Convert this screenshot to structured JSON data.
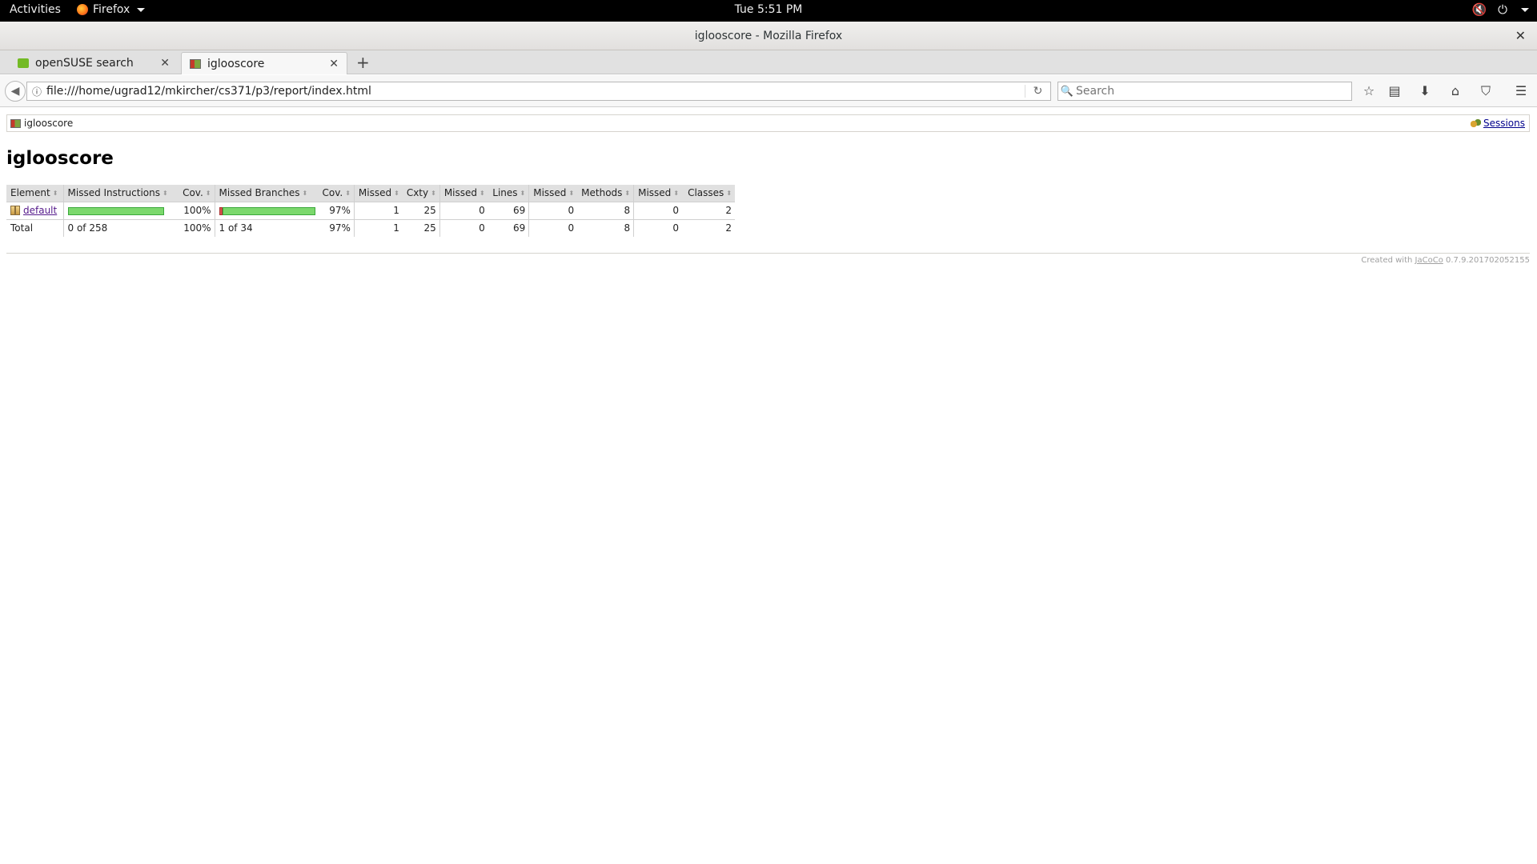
{
  "topbar": {
    "activities": "Activities",
    "app_name": "Firefox",
    "clock": "Tue  5:51 PM"
  },
  "window": {
    "title": "iglooscore - Mozilla Firefox"
  },
  "tabs": [
    {
      "label": "openSUSE search",
      "active": false
    },
    {
      "label": "iglooscore",
      "active": true
    }
  ],
  "navbar": {
    "url": "file:///home/ugrad12/mkircher/cs371/p3/report/index.html",
    "search_placeholder": "Search"
  },
  "report": {
    "breadcrumb": "iglooscore",
    "sessions_label": "Sessions",
    "title": "iglooscore",
    "headers": {
      "element": "Element",
      "missed_instructions": "Missed Instructions",
      "cov1": "Cov.",
      "missed_branches": "Missed Branches",
      "cov2": "Cov.",
      "missed_cxty": "Missed",
      "cxty": "Cxty",
      "missed_lines": "Missed",
      "lines": "Lines",
      "missed_methods": "Missed",
      "methods": "Methods",
      "missed_classes": "Missed",
      "classes": "Classes"
    },
    "rows": [
      {
        "element": "default",
        "instr_cov_pct": "100%",
        "instr_coverage_fraction": 1.0,
        "branch_cov_pct": "97%",
        "branch_coverage_fraction": 0.97,
        "missed_cxty": "1",
        "cxty": "25",
        "missed_lines": "0",
        "lines": "69",
        "missed_methods": "0",
        "methods": "8",
        "missed_classes": "0",
        "classes": "2"
      }
    ],
    "total": {
      "label": "Total",
      "missed_instructions": "0 of 258",
      "cov1": "100%",
      "missed_branches": "1 of 34",
      "cov2": "97%",
      "missed_cxty": "1",
      "cxty": "25",
      "missed_lines": "0",
      "lines": "69",
      "missed_methods": "0",
      "methods": "8",
      "missed_classes": "0",
      "classes": "2"
    },
    "footer": {
      "created_with": "Created with",
      "tool": "JaCoCo",
      "version": "0.7.9.201702052155"
    }
  },
  "colors": {
    "coverage_green": "#7bd86c",
    "coverage_red": "#d9534f",
    "header_bg": "#e0e0e0"
  }
}
